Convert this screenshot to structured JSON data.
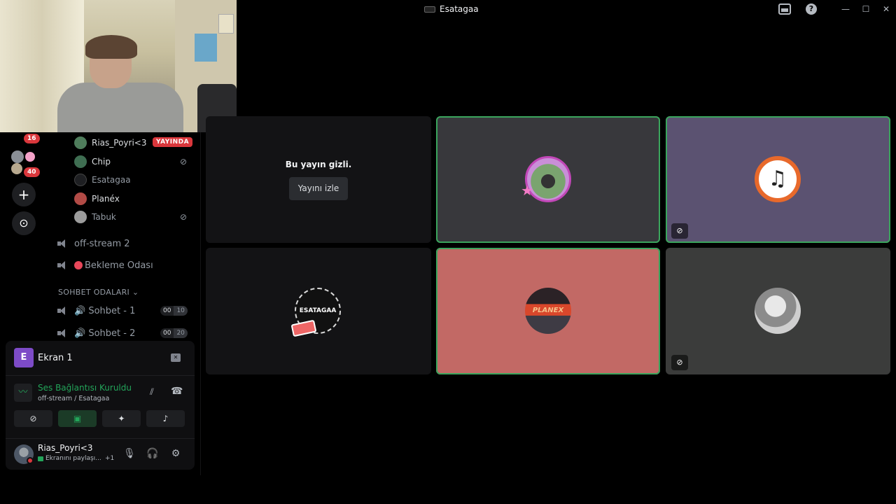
{
  "titlebar": {
    "title": "Esatagaa",
    "help": "?",
    "minimize": "—",
    "maximize": "☐",
    "close": "✕"
  },
  "rail": {
    "badge_top": "16",
    "badge_folder": "40",
    "add": "+",
    "explore": "⊙"
  },
  "members": [
    {
      "name": "Rias_Poyri<3",
      "badge": "YAYINDA"
    },
    {
      "name": "Chip"
    },
    {
      "name": "Esatagaa"
    },
    {
      "name": "Planéx"
    },
    {
      "name": "Tabuk"
    }
  ],
  "channels": {
    "offstream": "off-stream 2",
    "waiting": "Bekleme Odası",
    "category": "SOHBET ODALARI ⌄",
    "chat1": {
      "name": "🔊 Sohbet - 1",
      "count": "00",
      "limit": "10"
    },
    "chat2": {
      "name": "🔊 Sohbet - 2",
      "count": "00",
      "limit": "20"
    }
  },
  "panel": {
    "screen_letter": "E",
    "screen_label": "Ekran 1",
    "voice_status": "Ses Bağlantısı Kuruldu",
    "voice_channel": "off-stream / Esatagaa",
    "user_name": "Rias_Poyri<3",
    "user_status": "Ekranını paylaşı...",
    "user_status_extra": "+1"
  },
  "grid": {
    "hidden_text": "Bu yayın gizli.",
    "watch_label": "Yayını izle",
    "esatagaa_label": "ESATAGAA",
    "planex_label": "PLANEX"
  },
  "colors": {
    "accent_green": "#23a55a",
    "live_red": "#da373c",
    "tile_purple": "#5b5271",
    "tile_salmon": "#c26965"
  }
}
